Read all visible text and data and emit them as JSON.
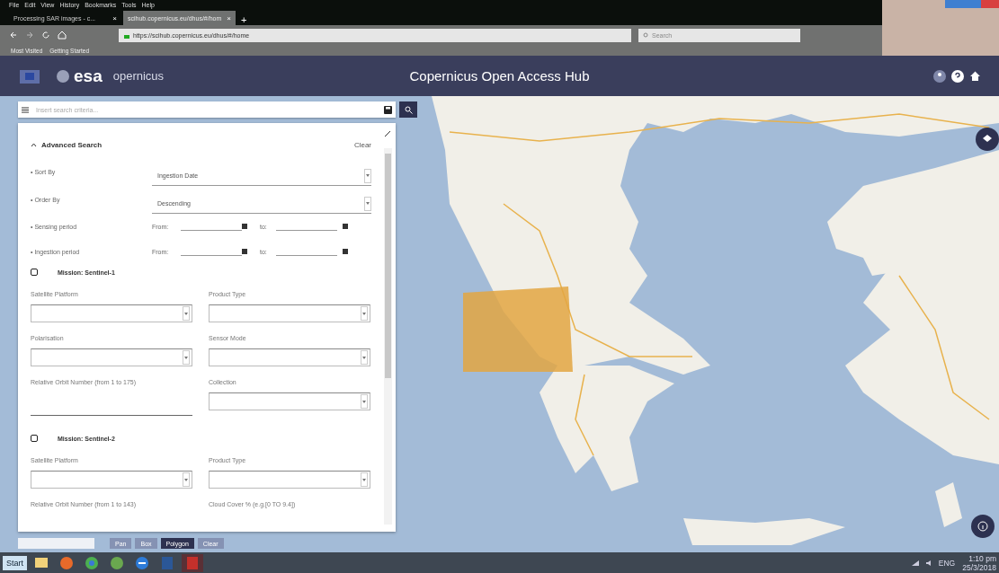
{
  "browser": {
    "menu": [
      "File",
      "Edit",
      "View",
      "History",
      "Bookmarks",
      "Tools",
      "Help"
    ],
    "tabs": [
      {
        "title": "Processing SAR images - c...",
        "selected": false
      },
      {
        "title": "scihub.copernicus.eu/dhus/#/hom",
        "selected": true
      }
    ],
    "address": "https://scihub.copernicus.eu/dhus/#/home",
    "search_placeholder": "Search",
    "bookmarks": [
      "Most Visited",
      "Getting Started"
    ],
    "tab_close": "×",
    "new_tab": "+"
  },
  "header": {
    "logo_text": "esa",
    "brand": "opernicus",
    "title": "Copernicus Open Access Hub"
  },
  "search": {
    "placeholder": "Insert search criteria..."
  },
  "advanced": {
    "title": "Advanced Search",
    "expanded": true,
    "clear": "Clear",
    "sort": [
      {
        "label": "• Sort By",
        "value": "Ingestion Date"
      },
      {
        "label": "• Order By",
        "value": "Descending"
      }
    ],
    "periods": [
      {
        "label": "• Sensing period",
        "from": "From:",
        "to": "to:"
      },
      {
        "label": "• Ingestion period",
        "from": "From:",
        "to": "to:"
      }
    ],
    "missions": [
      {
        "title": "Mission: Sentinel-1",
        "checked": false,
        "fields": [
          {
            "kind": "select",
            "label": "Satellite Platform"
          },
          {
            "kind": "select",
            "label": "Product Type"
          },
          {
            "kind": "select",
            "label": "Polarisation"
          },
          {
            "kind": "select",
            "label": "Sensor Mode"
          },
          {
            "kind": "text",
            "label": "Relative Orbit Number (from 1 to 175)"
          },
          {
            "kind": "select",
            "label": "Collection"
          }
        ]
      },
      {
        "title": "Mission: Sentinel-2",
        "checked": false,
        "fields": [
          {
            "kind": "select",
            "label": "Satellite Platform"
          },
          {
            "kind": "select",
            "label": "Product Type"
          },
          {
            "kind": "caption",
            "label": "Relative Orbit Number (from 1 to 143)"
          },
          {
            "kind": "caption",
            "label": "Cloud Cover % (e.g.[0 TO 9.4])"
          }
        ]
      }
    ]
  },
  "draw_tools": [
    {
      "label": "Pan",
      "selected": false
    },
    {
      "label": "Box",
      "selected": false
    },
    {
      "label": "Polygon",
      "selected": true
    },
    {
      "label": "Clear",
      "selected": false
    }
  ],
  "taskbar": {
    "start": "Start",
    "language": "ENG",
    "time": "1:10 pm",
    "date": "25/3/2018"
  }
}
